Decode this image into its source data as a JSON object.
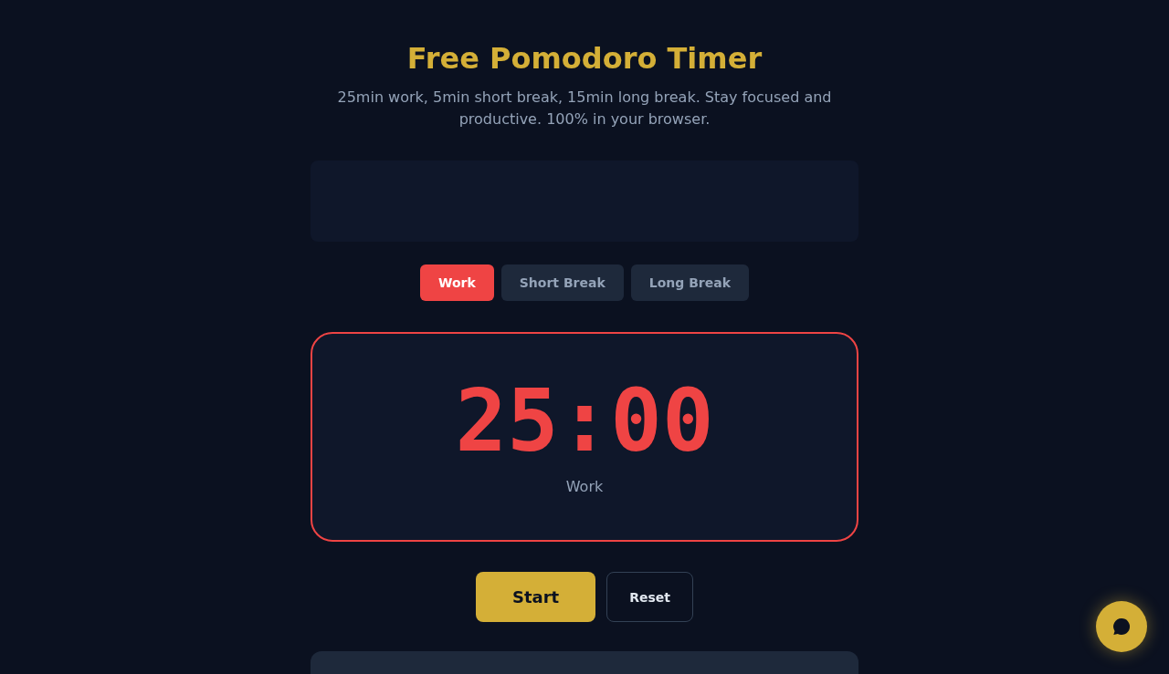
{
  "header": {
    "title": "Free Pomodoro Timer",
    "subtitle": "25min work, 5min short break, 15min long break. Stay focused and productive. 100% in your browser."
  },
  "mode_tabs": [
    {
      "label": "Work",
      "selected": true
    },
    {
      "label": "Short Break",
      "selected": false
    },
    {
      "label": "Long Break",
      "selected": false
    }
  ],
  "timer": {
    "time": "25:00",
    "mode_label": "Work"
  },
  "controls": [
    {
      "label": "Start",
      "kind": "primary"
    },
    {
      "label": "Reset",
      "kind": "secondary"
    }
  ]
}
